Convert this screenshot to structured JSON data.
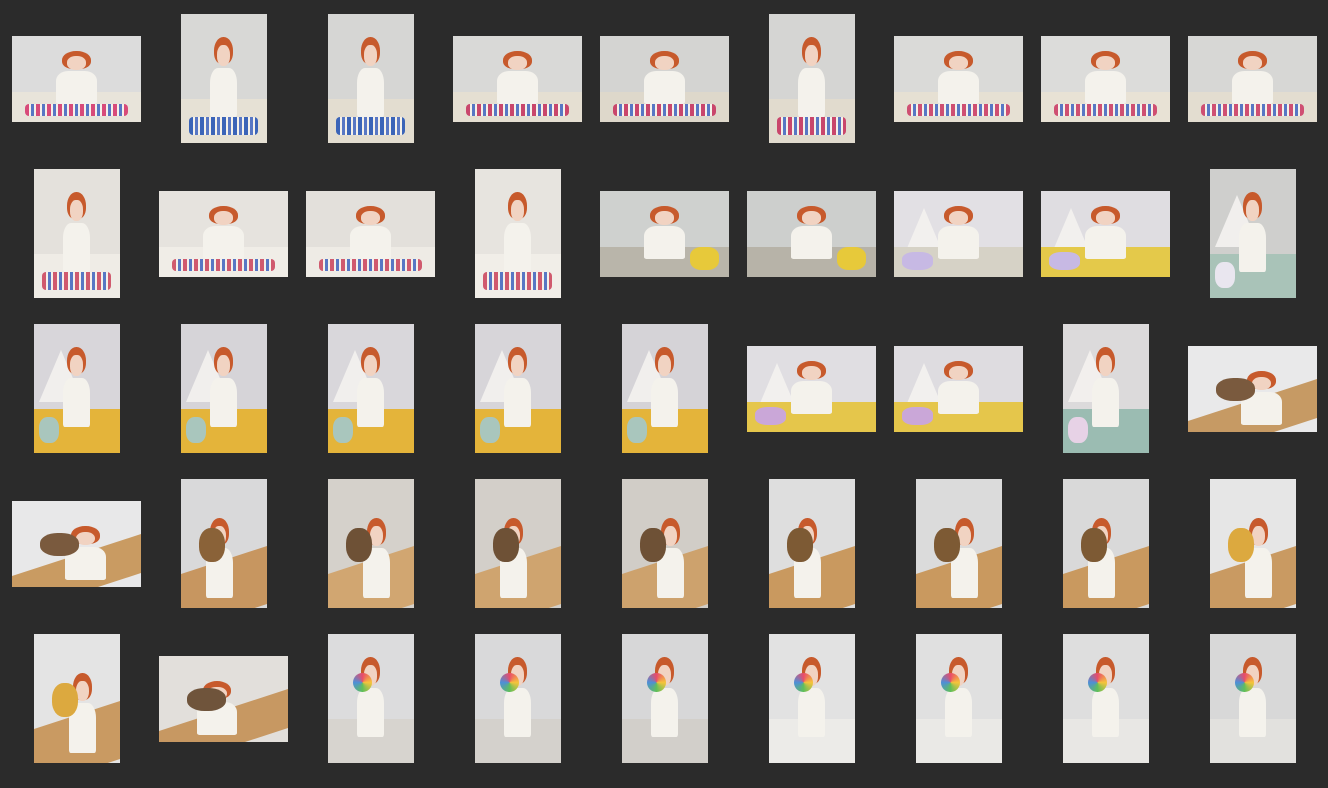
{
  "palette": {
    "background": "#2b2b2b",
    "hair": "#c75a2c",
    "skin": "#f1d3c2",
    "shirt": "#f4f2ec"
  },
  "thumbnails": [
    {
      "orientation": "landscape",
      "scene": "nail-polish",
      "wall": "#dcdcdc",
      "floor": "#e8e4da",
      "prop": "#d84b7a",
      "prop_icon": "nail-polish-icon"
    },
    {
      "orientation": "portrait",
      "scene": "nail-polish",
      "wall": "#d8d8d6",
      "floor": "#e6e1d5",
      "prop": "#3b64b8",
      "prop_icon": "nail-polish-icon"
    },
    {
      "orientation": "portrait",
      "scene": "nail-polish",
      "wall": "#d6d6d4",
      "floor": "#e3ddd0",
      "prop": "#3b64b8",
      "prop_icon": "nail-polish-icon"
    },
    {
      "orientation": "landscape",
      "scene": "nail-polish",
      "wall": "#d9d9d7",
      "floor": "#e5dfd2",
      "prop": "#c9466c",
      "prop_icon": "nail-polish-icon"
    },
    {
      "orientation": "landscape",
      "scene": "nail-polish",
      "wall": "#d4d4d2",
      "floor": "#ded8cb",
      "prop": "#c9466c",
      "prop_icon": "nail-polish-icon"
    },
    {
      "orientation": "portrait",
      "scene": "nail-polish",
      "wall": "#d5d5d3",
      "floor": "#e1dbce",
      "prop": "#c9466c",
      "prop_icon": "nail-polish-icon"
    },
    {
      "orientation": "landscape",
      "scene": "nail-polish",
      "wall": "#dadad8",
      "floor": "#e6e0d3",
      "prop": "#cf4f72",
      "prop_icon": "nail-polish-icon"
    },
    {
      "orientation": "landscape",
      "scene": "nail-polish",
      "wall": "#dcdcda",
      "floor": "#e8e2d5",
      "prop": "#cf4f72",
      "prop_icon": "nail-polish-icon"
    },
    {
      "orientation": "landscape",
      "scene": "nail-polish",
      "wall": "#d7d7d5",
      "floor": "#e3ddd0",
      "prop": "#cf4f72",
      "prop_icon": "nail-polish-icon"
    },
    {
      "orientation": "portrait",
      "scene": "bookshelf",
      "wall": "#e4e1dc",
      "floor": "#efece6",
      "prop": "#d05a6e",
      "prop_icon": "nail-polish-icon"
    },
    {
      "orientation": "landscape",
      "scene": "bookshelf",
      "wall": "#e6e3de",
      "floor": "#f0ede7",
      "prop": "#d05a6e",
      "prop_icon": "nail-polish-icon"
    },
    {
      "orientation": "landscape",
      "scene": "bookshelf",
      "wall": "#e3e0db",
      "floor": "#eeebe5",
      "prop": "#d05a6e",
      "prop_icon": "nail-polish-icon"
    },
    {
      "orientation": "portrait",
      "scene": "bookshelf",
      "wall": "#e7e4df",
      "floor": "#f1eee8",
      "prop": "#d05a6e",
      "prop_icon": "nail-polish-icon"
    },
    {
      "orientation": "landscape",
      "scene": "plush-toys",
      "wall": "#cfd1cf",
      "floor": "#b9b5aa",
      "prop": "#e7c93a",
      "prop_icon": "plush-toy-icon"
    },
    {
      "orientation": "landscape",
      "scene": "plush-toys",
      "wall": "#cdcfcd",
      "floor": "#b7b3a8",
      "prop": "#e7c93a",
      "prop_icon": "plush-toy-icon"
    },
    {
      "orientation": "landscape",
      "scene": "tent",
      "wall": "#e2e0e4",
      "floor": "#d6d2c6",
      "prop": "#c7b9e4",
      "prop_icon": "plush-toy-icon"
    },
    {
      "orientation": "landscape",
      "scene": "tent",
      "wall": "#dfdde1",
      "floor": "#e4c94a",
      "prop": "#c7b9e4",
      "prop_icon": "plush-toy-icon"
    },
    {
      "orientation": "portrait",
      "scene": "tent",
      "wall": "#cfcfcd",
      "floor": "#a9c3b8",
      "prop": "#e9e6ef",
      "prop_icon": "tent-icon"
    },
    {
      "orientation": "portrait",
      "scene": "tent",
      "wall": "#d8d6da",
      "floor": "#e4b43a",
      "prop": "#a9c6bd",
      "prop_icon": "tent-icon"
    },
    {
      "orientation": "portrait",
      "scene": "tent",
      "wall": "#d6d4d8",
      "floor": "#e4b43a",
      "prop": "#a9c6bd",
      "prop_icon": "tent-icon"
    },
    {
      "orientation": "portrait",
      "scene": "tent",
      "wall": "#d9d7db",
      "floor": "#e4b43a",
      "prop": "#a9c6bd",
      "prop_icon": "tent-icon"
    },
    {
      "orientation": "portrait",
      "scene": "tent",
      "wall": "#d7d5d9",
      "floor": "#e4b43a",
      "prop": "#a9c6bd",
      "prop_icon": "tent-icon"
    },
    {
      "orientation": "portrait",
      "scene": "tent",
      "wall": "#d5d3d7",
      "floor": "#e4b43a",
      "prop": "#a9c6bd",
      "prop_icon": "tent-icon"
    },
    {
      "orientation": "landscape",
      "scene": "tent",
      "wall": "#e0dee2",
      "floor": "#e5c64b",
      "prop": "#caa7d8",
      "prop_icon": "tent-icon"
    },
    {
      "orientation": "landscape",
      "scene": "tent",
      "wall": "#dedce0",
      "floor": "#e5c64b",
      "prop": "#caa7d8",
      "prop_icon": "tent-icon"
    },
    {
      "orientation": "portrait",
      "scene": "tent",
      "wall": "#dcdadb",
      "floor": "#9bbcb2",
      "prop": "#e7d2e6",
      "prop_icon": "tent-icon"
    },
    {
      "orientation": "landscape",
      "scene": "slide",
      "wall": "#e9e9ea",
      "floor": "#c69a64",
      "prop": "#7a5a3e",
      "prop_icon": "lion-plush-icon"
    },
    {
      "orientation": "landscape",
      "scene": "slide",
      "wall": "#e8e8e9",
      "floor": "#c99b62",
      "prop": "#7a5a3e",
      "prop_icon": "lion-plush-icon"
    },
    {
      "orientation": "portrait",
      "scene": "slide",
      "wall": "#d9d9da",
      "floor": "#c79660",
      "prop": "#8a6238",
      "prop_icon": "lion-plush-icon"
    },
    {
      "orientation": "portrait",
      "scene": "slide",
      "wall": "#d5d1cb",
      "floor": "#d1a671",
      "prop": "#6e5136",
      "prop_icon": "lion-plush-icon"
    },
    {
      "orientation": "portrait",
      "scene": "slide",
      "wall": "#d3cfc9",
      "floor": "#cfa46f",
      "prop": "#6e5136",
      "prop_icon": "lion-plush-icon"
    },
    {
      "orientation": "portrait",
      "scene": "slide",
      "wall": "#d1cdc7",
      "floor": "#cda26d",
      "prop": "#6e5136",
      "prop_icon": "lion-plush-icon"
    },
    {
      "orientation": "portrait",
      "scene": "slide",
      "wall": "#dedede",
      "floor": "#c9995f",
      "prop": "#7d5a34",
      "prop_icon": "lion-plush-icon"
    },
    {
      "orientation": "portrait",
      "scene": "slide",
      "wall": "#dbdbdb",
      "floor": "#c9995f",
      "prop": "#7d5a34",
      "prop_icon": "lion-plush-icon"
    },
    {
      "orientation": "portrait",
      "scene": "slide",
      "wall": "#d9d9d9",
      "floor": "#c9995f",
      "prop": "#7d5a34",
      "prop_icon": "lion-plush-icon"
    },
    {
      "orientation": "portrait",
      "scene": "slide",
      "wall": "#e6e6e6",
      "floor": "#c99a62",
      "prop": "#dca93f",
      "prop_icon": "lion-plush-icon"
    },
    {
      "orientation": "portrait",
      "scene": "slide",
      "wall": "#e4e4e4",
      "floor": "#c99a62",
      "prop": "#dca93f",
      "prop_icon": "lion-plush-icon"
    },
    {
      "orientation": "landscape",
      "scene": "slide",
      "wall": "#e2dfdb",
      "floor": "#c79862",
      "prop": "#6f543b",
      "prop_icon": "lion-plush-icon"
    },
    {
      "orientation": "portrait",
      "scene": "lollipop",
      "wall": "#dcdcdd",
      "floor": "#d7d4cf",
      "prop": "#dca52f",
      "prop_icon": "lollipop-icon"
    },
    {
      "orientation": "portrait",
      "scene": "lollipop",
      "wall": "#d9d9da",
      "floor": "#d4d1cc",
      "prop": "#dca52f",
      "prop_icon": "lollipop-icon"
    },
    {
      "orientation": "portrait",
      "scene": "lollipop",
      "wall": "#d7d7d8",
      "floor": "#d2cfca",
      "prop": "#dca52f",
      "prop_icon": "lollipop-icon"
    },
    {
      "orientation": "portrait",
      "scene": "lollipop",
      "wall": "#e2e2e2",
      "floor": "#ecebe8",
      "prop": "#e6a72f",
      "prop_icon": "lollipop-icon"
    },
    {
      "orientation": "portrait",
      "scene": "lollipop",
      "wall": "#e0e0e0",
      "floor": "#eae9e6",
      "prop": "#e6a72f",
      "prop_icon": "lollipop-icon"
    },
    {
      "orientation": "portrait",
      "scene": "lollipop",
      "wall": "#dedede",
      "floor": "#e8e7e4",
      "prop": "#e6a72f",
      "prop_icon": "lollipop-icon"
    },
    {
      "orientation": "portrait",
      "scene": "lollipop",
      "wall": "#d8d8d8",
      "floor": "#e2e1de",
      "prop": "#8fcf64",
      "prop_icon": "lollipop-icon"
    }
  ]
}
